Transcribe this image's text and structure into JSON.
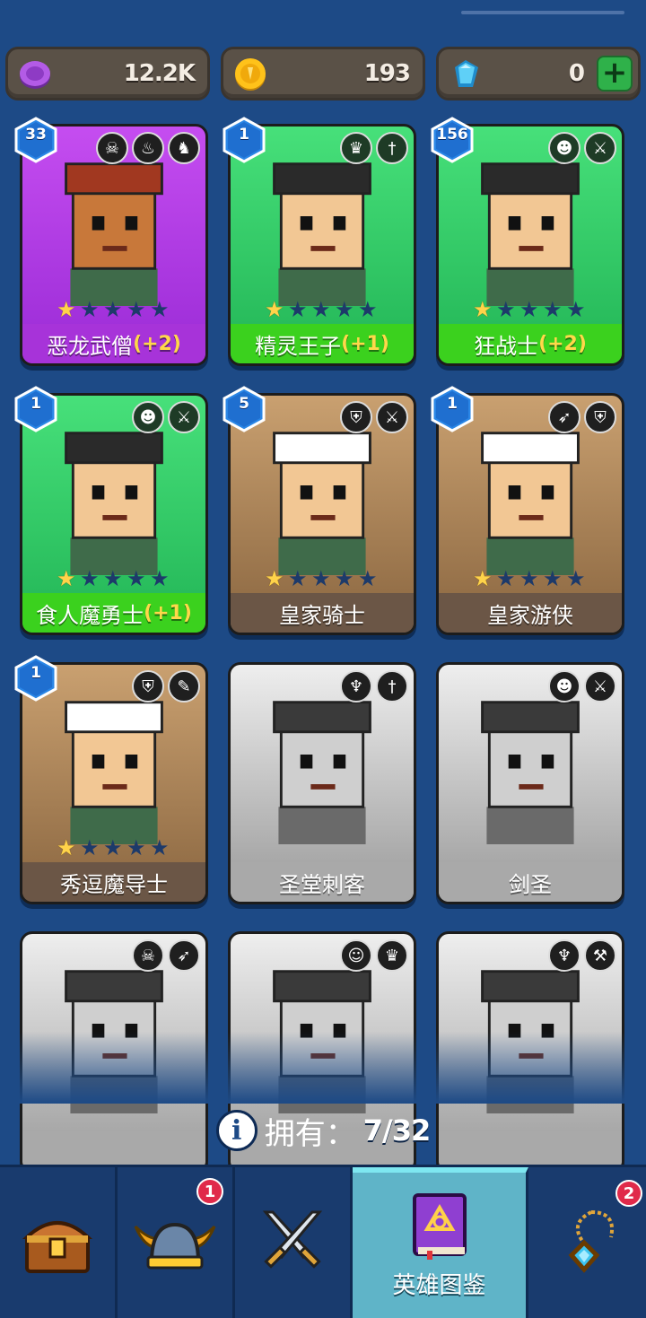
{
  "currencies": {
    "amethyst": {
      "value": "12.2K",
      "icon": "purple-coin-icon",
      "color": "#a44fd6"
    },
    "gold": {
      "value": "193",
      "icon": "gold-coin-icon",
      "color": "#ffc21a"
    },
    "gems": {
      "value": "0",
      "icon": "blue-gem-icon",
      "color": "#3cb7ee",
      "add_label": "+"
    }
  },
  "heroes": [
    {
      "name": "恶龙武僧",
      "bonus": "(+2)",
      "level": "33",
      "rarity": "purple",
      "stars": 1,
      "owned": true,
      "badges": [
        "skull-icon",
        "fire-swirl-icon",
        "dragon-icon"
      ]
    },
    {
      "name": "精灵王子",
      "bonus": "(+1)",
      "level": "1",
      "rarity": "green",
      "stars": 1,
      "owned": true,
      "badges": [
        "elf-icon",
        "dagger-icon"
      ]
    },
    {
      "name": "狂战士",
      "bonus": "(+2)",
      "level": "156",
      "rarity": "green",
      "stars": 1,
      "owned": true,
      "badges": [
        "orc-icon",
        "sword-icon"
      ]
    },
    {
      "name": "食人魔勇士",
      "bonus": "(+1)",
      "level": "1",
      "rarity": "green",
      "stars": 1,
      "owned": true,
      "badges": [
        "orc-icon",
        "sword-icon"
      ]
    },
    {
      "name": "皇家骑士",
      "bonus": "",
      "level": "5",
      "rarity": "brown",
      "stars": 1,
      "owned": true,
      "badges": [
        "helmet-icon",
        "sword-icon"
      ]
    },
    {
      "name": "皇家游侠",
      "bonus": "",
      "level": "1",
      "rarity": "brown",
      "stars": 1,
      "owned": true,
      "badges": [
        "bow-icon",
        "helmet-icon"
      ]
    },
    {
      "name": "秀逗魔导士",
      "bonus": "",
      "level": "1",
      "rarity": "brown",
      "stars": 1,
      "owned": true,
      "badges": [
        "helmet-icon",
        "wand-icon"
      ]
    },
    {
      "name": "圣堂刺客",
      "bonus": "",
      "level": "",
      "rarity": "gray",
      "stars": 0,
      "owned": false,
      "badges": [
        "angel-wings-icon",
        "dagger-icon"
      ]
    },
    {
      "name": "剑圣",
      "bonus": "",
      "level": "",
      "rarity": "gray",
      "stars": 0,
      "owned": false,
      "badges": [
        "orc-icon",
        "sword-icon"
      ]
    },
    {
      "name": "",
      "bonus": "",
      "level": "",
      "rarity": "gray",
      "stars": 0,
      "owned": false,
      "badges": [
        "skull-icon",
        "bow-icon"
      ]
    },
    {
      "name": "",
      "bonus": "",
      "level": "",
      "rarity": "gray",
      "stars": 0,
      "owned": false,
      "badges": [
        "goblin-icon",
        "elf-icon"
      ]
    },
    {
      "name": "",
      "bonus": "",
      "level": "",
      "rarity": "gray",
      "stars": 0,
      "owned": false,
      "badges": [
        "angel-wings-icon",
        "hammer-icon"
      ]
    }
  ],
  "owned": {
    "label": "拥有：",
    "count": "7/32"
  },
  "nav": [
    {
      "name": "treasure-chest",
      "icon": "treasure-chest-icon",
      "label": "",
      "badge": ""
    },
    {
      "name": "viking-helmet",
      "icon": "viking-helmet-icon",
      "label": "",
      "badge": "1"
    },
    {
      "name": "battle",
      "icon": "crossed-swords-icon",
      "label": "",
      "badge": ""
    },
    {
      "name": "hero-codex",
      "icon": "spellbook-icon",
      "label": "英雄图鉴",
      "badge": "",
      "active": true
    },
    {
      "name": "amulet",
      "icon": "amulet-icon",
      "label": "",
      "badge": "2"
    }
  ]
}
